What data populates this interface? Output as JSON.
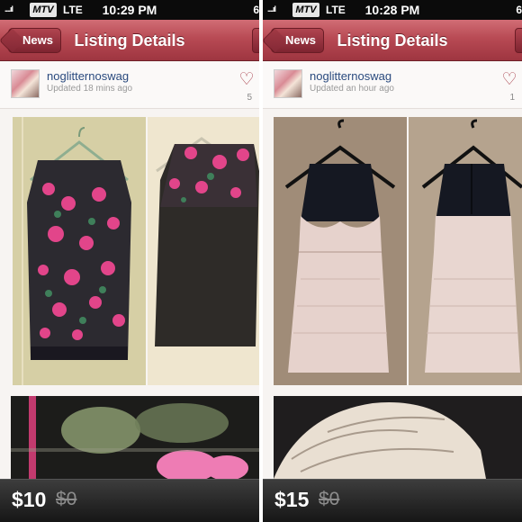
{
  "screens": [
    {
      "status": {
        "signal": "....ıl",
        "carrier": "MTV",
        "network": "LTE",
        "time": "10:29 PM",
        "battery": "6"
      },
      "nav": {
        "back_label": "News",
        "title": "Listing Details"
      },
      "user": {
        "name": "noglitternoswag",
        "updated": "Updated 18 mins ago",
        "likes": "5",
        "heart_icon": "heart-outline-icon"
      },
      "price": {
        "current": "$10",
        "original": "$0"
      }
    },
    {
      "status": {
        "signal": "....ıl",
        "carrier": "MTV",
        "network": "LTE",
        "time": "10:28 PM",
        "battery": "6"
      },
      "nav": {
        "back_label": "News",
        "title": "Listing Details"
      },
      "user": {
        "name": "noglitternoswag",
        "updated": "Updated an hour ago",
        "likes": "1",
        "heart_icon": "heart-outline-icon"
      },
      "price": {
        "current": "$15",
        "original": "$0"
      }
    }
  ],
  "colors": {
    "nav_red": "#b84a54",
    "link_blue": "#2a4a7e",
    "heart": "#a8404c",
    "price_bar": "#222222"
  }
}
